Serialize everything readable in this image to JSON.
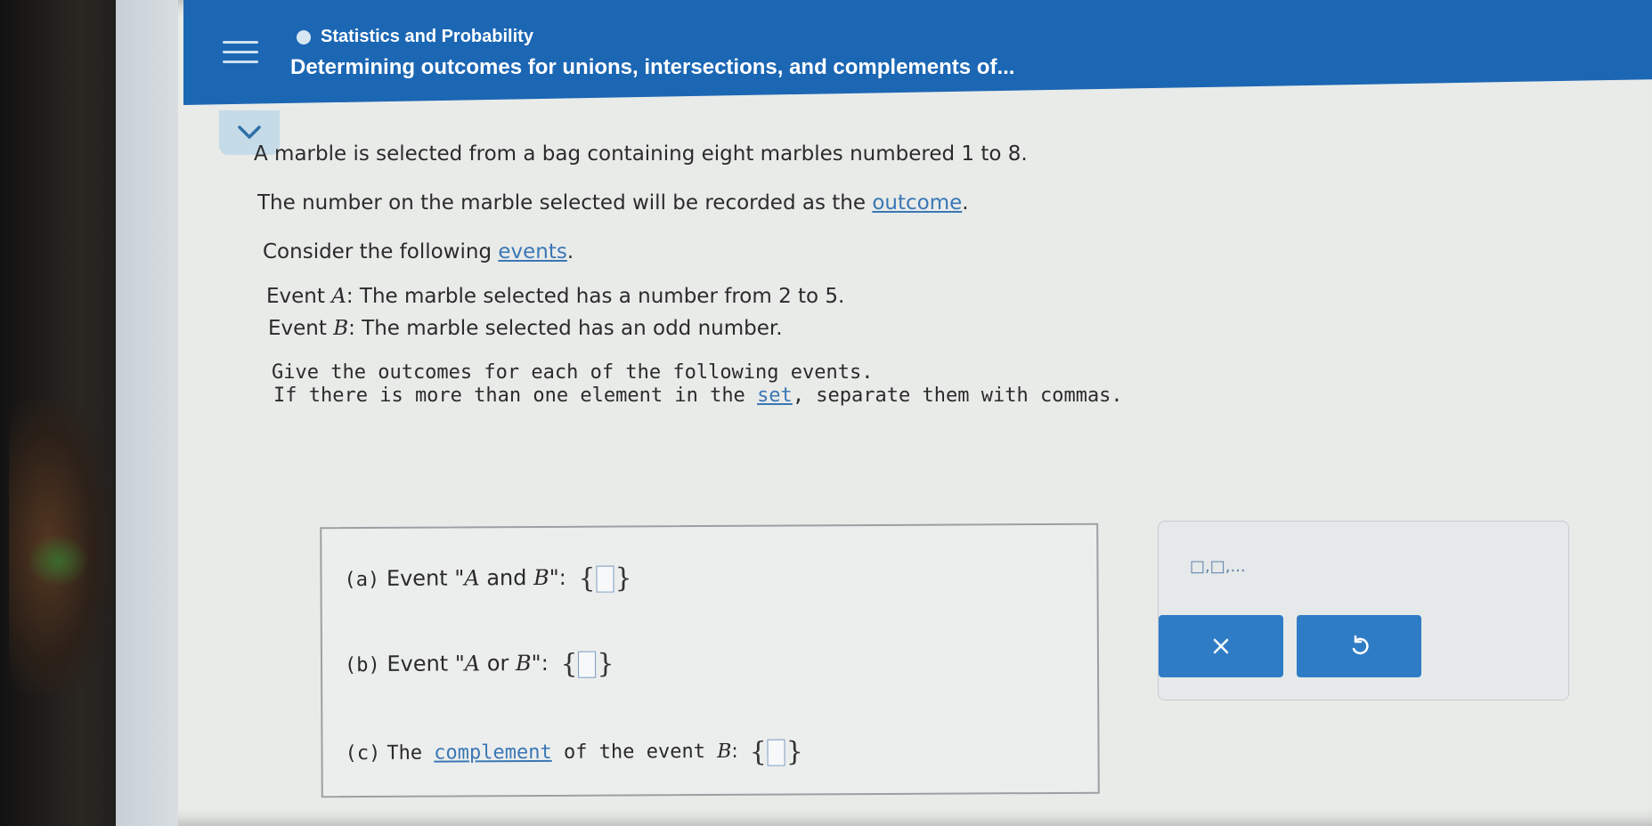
{
  "header": {
    "topic": "Statistics and Probability",
    "title": "Determining outcomes for unions, intersections, and complements of..."
  },
  "problem": {
    "line1": "A marble is selected from a bag containing eight marbles numbered 1 to 8.",
    "line2_pre": "The number on the marble selected will be recorded as the ",
    "line2_link": "outcome",
    "line2_post": ".",
    "line3_pre": "Consider the following ",
    "line3_link": "events",
    "line3_post": ".",
    "eventA_pre": "Event ",
    "eventA_var": "A",
    "eventA_post": ": The marble selected has a number from 2 to 5.",
    "eventB_pre": "Event ",
    "eventB_var": "B",
    "eventB_post": ": The marble selected has an odd number.",
    "instruction1": "Give the outcomes for each of the following events.",
    "instruction2_pre": "If there is more than one element in the ",
    "instruction2_link": "set",
    "instruction2_post": ", separate them with commas."
  },
  "answers": {
    "a_letter": "(a)",
    "a_text_pre": "Event \"",
    "a_var1": "A",
    "a_and": " and ",
    "a_var2": "B",
    "a_text_post": "\":",
    "b_letter": "(b)",
    "b_text_pre": "Event \"",
    "b_var1": "A",
    "b_or": " or ",
    "b_var2": "B",
    "b_text_post": "\":",
    "c_letter": "(c)",
    "c_text_pre": "The ",
    "c_link": "complement",
    "c_text_mid": " of the event ",
    "c_var": "B",
    "c_text_post": ":",
    "brace_open": "{",
    "brace_close": "}"
  },
  "toolbar": {
    "set_symbol": "□,□,..."
  },
  "colors": {
    "header_blue": "#1c67b4",
    "button_blue": "#2f7cc6",
    "link_blue": "#3a77b5"
  },
  "icons": {
    "menu": "hamburger-menu-icon",
    "topic": "topic-dot-icon",
    "collapse": "chevron-down-icon",
    "clear": "x-icon",
    "undo": "undo-icon"
  }
}
